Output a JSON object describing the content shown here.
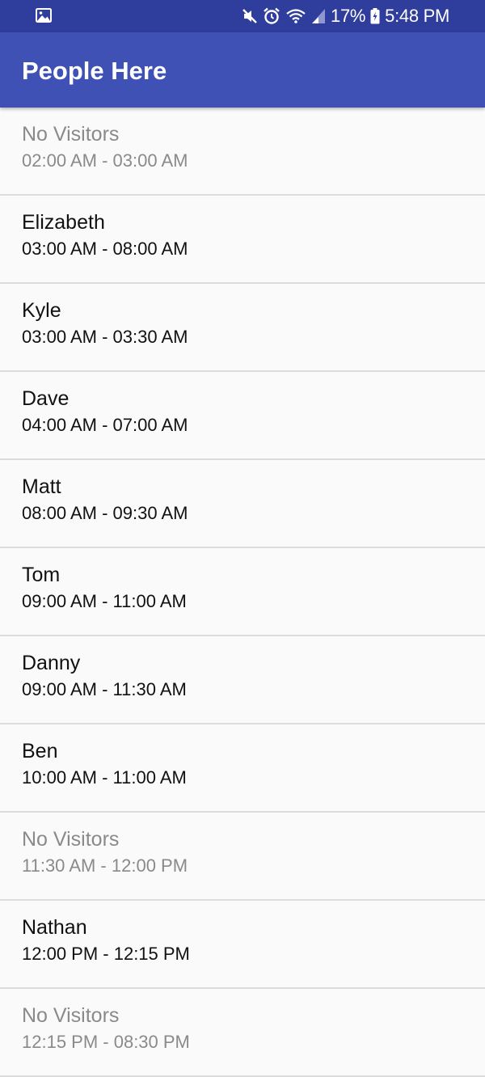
{
  "status_bar": {
    "left_icon": "image-icon",
    "icons": [
      "mute-icon",
      "alarm-icon",
      "wifi-icon",
      "signal-icon",
      "battery-charging-icon"
    ],
    "battery": "17%",
    "time": "5:48 PM"
  },
  "app_bar": {
    "title": "People Here",
    "color": "#3f51b5",
    "status_color": "#2f3d9c"
  },
  "list": {
    "items": [
      {
        "name": "No Visitors",
        "time": "02:00 AM - 03:00 AM",
        "empty": true
      },
      {
        "name": "Elizabeth",
        "time": "03:00 AM - 08:00 AM",
        "empty": false
      },
      {
        "name": "Kyle",
        "time": "03:00 AM - 03:30 AM",
        "empty": false
      },
      {
        "name": "Dave",
        "time": "04:00 AM - 07:00 AM",
        "empty": false
      },
      {
        "name": "Matt",
        "time": "08:00 AM - 09:30 AM",
        "empty": false
      },
      {
        "name": "Tom",
        "time": "09:00 AM - 11:00 AM",
        "empty": false
      },
      {
        "name": "Danny",
        "time": "09:00 AM - 11:30 AM",
        "empty": false
      },
      {
        "name": "Ben",
        "time": "10:00 AM - 11:00 AM",
        "empty": false
      },
      {
        "name": "No Visitors",
        "time": "11:30 AM - 12:00 PM",
        "empty": true
      },
      {
        "name": "Nathan",
        "time": "12:00 PM - 12:15 PM",
        "empty": false
      },
      {
        "name": "No Visitors",
        "time": "12:15 PM - 08:30 PM",
        "empty": true
      }
    ]
  }
}
